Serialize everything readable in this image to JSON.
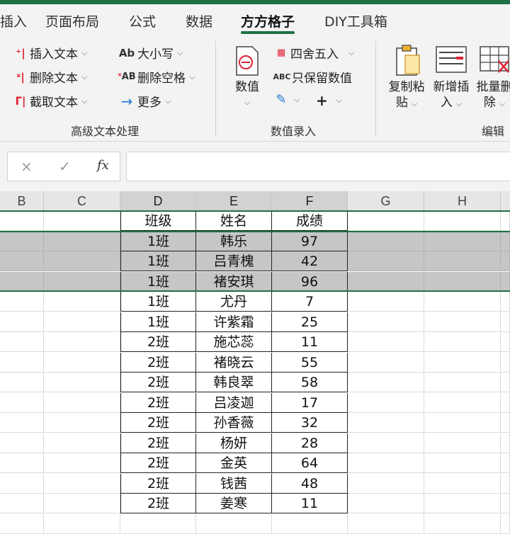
{
  "tabs": [
    "插入",
    "页面布局",
    "公式",
    "数据",
    "方方格子",
    "DIY工具箱"
  ],
  "active_tab": "方方格子",
  "ribbon": {
    "group1": {
      "label": "高级文本处理",
      "insert_text": "插入文本",
      "delete_text": "删除文本",
      "extract_text": "截取文本",
      "case": "大小写",
      "delete_space": "删除空格",
      "more": "更多"
    },
    "group2": {
      "label": "数值录入",
      "value": "数值",
      "round": "四舍五入",
      "keep_value": "只保留数值",
      "plus": "+"
    },
    "group3": {
      "label": "编辑",
      "copy_paste_1": "复制粘",
      "copy_paste_2": "贴",
      "insert_new_1": "新增插",
      "insert_new_2": "入",
      "batch_delete_1": "批量删",
      "batch_delete_2": "除"
    }
  },
  "formula_bar": {
    "cancel": "×",
    "confirm": "✓",
    "fx": "fx",
    "value": ""
  },
  "columns": [
    "B",
    "C",
    "D",
    "E",
    "F",
    "G",
    "H"
  ],
  "table": {
    "headers": [
      "班级",
      "姓名",
      "成绩"
    ],
    "rows": [
      [
        "1班",
        "韩乐",
        "97"
      ],
      [
        "1班",
        "吕青槐",
        "42"
      ],
      [
        "1班",
        "褚安琪",
        "96"
      ],
      [
        "1班",
        "尤丹",
        "7"
      ],
      [
        "1班",
        "许紫霜",
        "25"
      ],
      [
        "2班",
        "施芯蕊",
        "11"
      ],
      [
        "2班",
        "褚晓云",
        "55"
      ],
      [
        "2班",
        "韩良翠",
        "58"
      ],
      [
        "2班",
        "吕凌迦",
        "17"
      ],
      [
        "2班",
        "孙香薇",
        "32"
      ],
      [
        "2班",
        "杨妍",
        "28"
      ],
      [
        "2班",
        "金英",
        "64"
      ],
      [
        "2班",
        "钱茜",
        "48"
      ],
      [
        "2班",
        "姜寒",
        "11"
      ]
    ]
  },
  "colors": {
    "accent": "#1e7145",
    "selection": "#c6c6c6"
  }
}
